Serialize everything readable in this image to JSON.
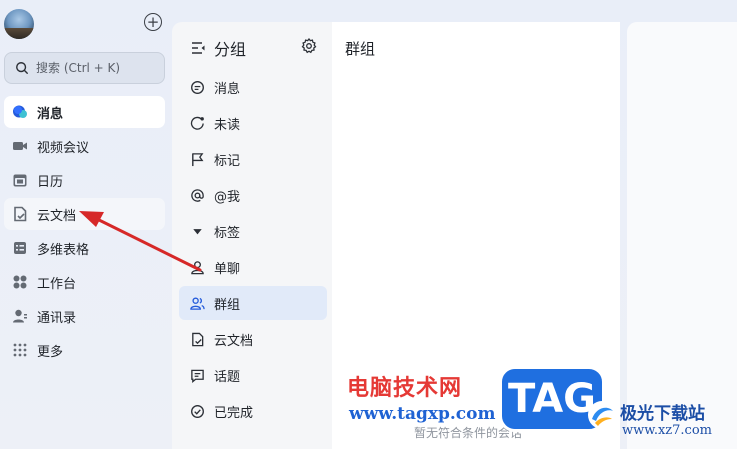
{
  "rail": {
    "search_placeholder": "搜索 (Ctrl + K)",
    "items": [
      {
        "label": "消息",
        "icon": "message-bubble-icon"
      },
      {
        "label": "视频会议",
        "icon": "video-camera-icon"
      },
      {
        "label": "日历",
        "icon": "calendar-icon"
      },
      {
        "label": "云文档",
        "icon": "cloud-doc-icon"
      },
      {
        "label": "多维表格",
        "icon": "table-icon"
      },
      {
        "label": "工作台",
        "icon": "workbench-grid-icon"
      },
      {
        "label": "通讯录",
        "icon": "contacts-icon"
      },
      {
        "label": "更多",
        "icon": "more-dots-icon"
      }
    ]
  },
  "groups": {
    "title": "分组",
    "items": [
      {
        "label": "消息",
        "icon": "chat-icon"
      },
      {
        "label": "未读",
        "icon": "unread-icon"
      },
      {
        "label": "标记",
        "icon": "flag-icon"
      },
      {
        "label": "@我",
        "icon": "at-icon"
      },
      {
        "label": "标签",
        "icon": "caret-down-icon"
      },
      {
        "label": "单聊",
        "icon": "user-icon"
      },
      {
        "label": "群组",
        "icon": "group-icon"
      },
      {
        "label": "云文档",
        "icon": "doc-icon"
      },
      {
        "label": "话题",
        "icon": "topic-icon"
      },
      {
        "label": "已完成",
        "icon": "check-circle-icon"
      }
    ]
  },
  "content": {
    "title": "群组",
    "empty_text": "暂无符合条件的会话"
  },
  "watermark": {
    "cn": "电脑技术网",
    "url": "www.tagxp.com",
    "tag": "TAG",
    "site": "极光下载站",
    "site_url": "www.xz7.com"
  },
  "colors": {
    "accent": "#245bdb",
    "active_group_bg": "#e1eaf9",
    "arrow": "#d62828"
  }
}
